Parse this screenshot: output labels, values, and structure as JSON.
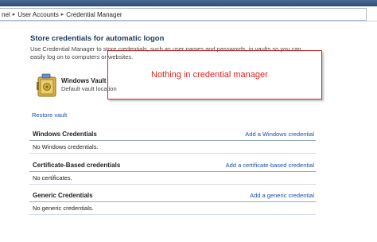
{
  "breadcrumb": {
    "items": [
      "nel",
      "User Accounts",
      "Credential Manager"
    ]
  },
  "main": {
    "heading": "Store credentials for automatic logon",
    "description": "Use Credential Manager to store credentials, such as user names and passwords, in vaults so you can easily log on to computers or websites.",
    "vault": {
      "title": "Windows Vault",
      "subtitle": "Default vault location"
    },
    "restore_label": "Restore vault",
    "sections": [
      {
        "title": "Windows Credentials",
        "add_label": "Add a Windows credential",
        "empty": "No Windows credentials."
      },
      {
        "title": "Certificate-Based credentials",
        "add_label": "Add a certificate-based credential",
        "empty": "No certificates."
      },
      {
        "title": "Generic Credentials",
        "add_label": "Add a generic credential",
        "empty": "No generic credentials."
      }
    ]
  },
  "annotation": {
    "text": "Nothing in credential manager"
  },
  "colors": {
    "link": "#1a4ea8",
    "heading": "#1e395b",
    "annotation": "#e02020"
  }
}
